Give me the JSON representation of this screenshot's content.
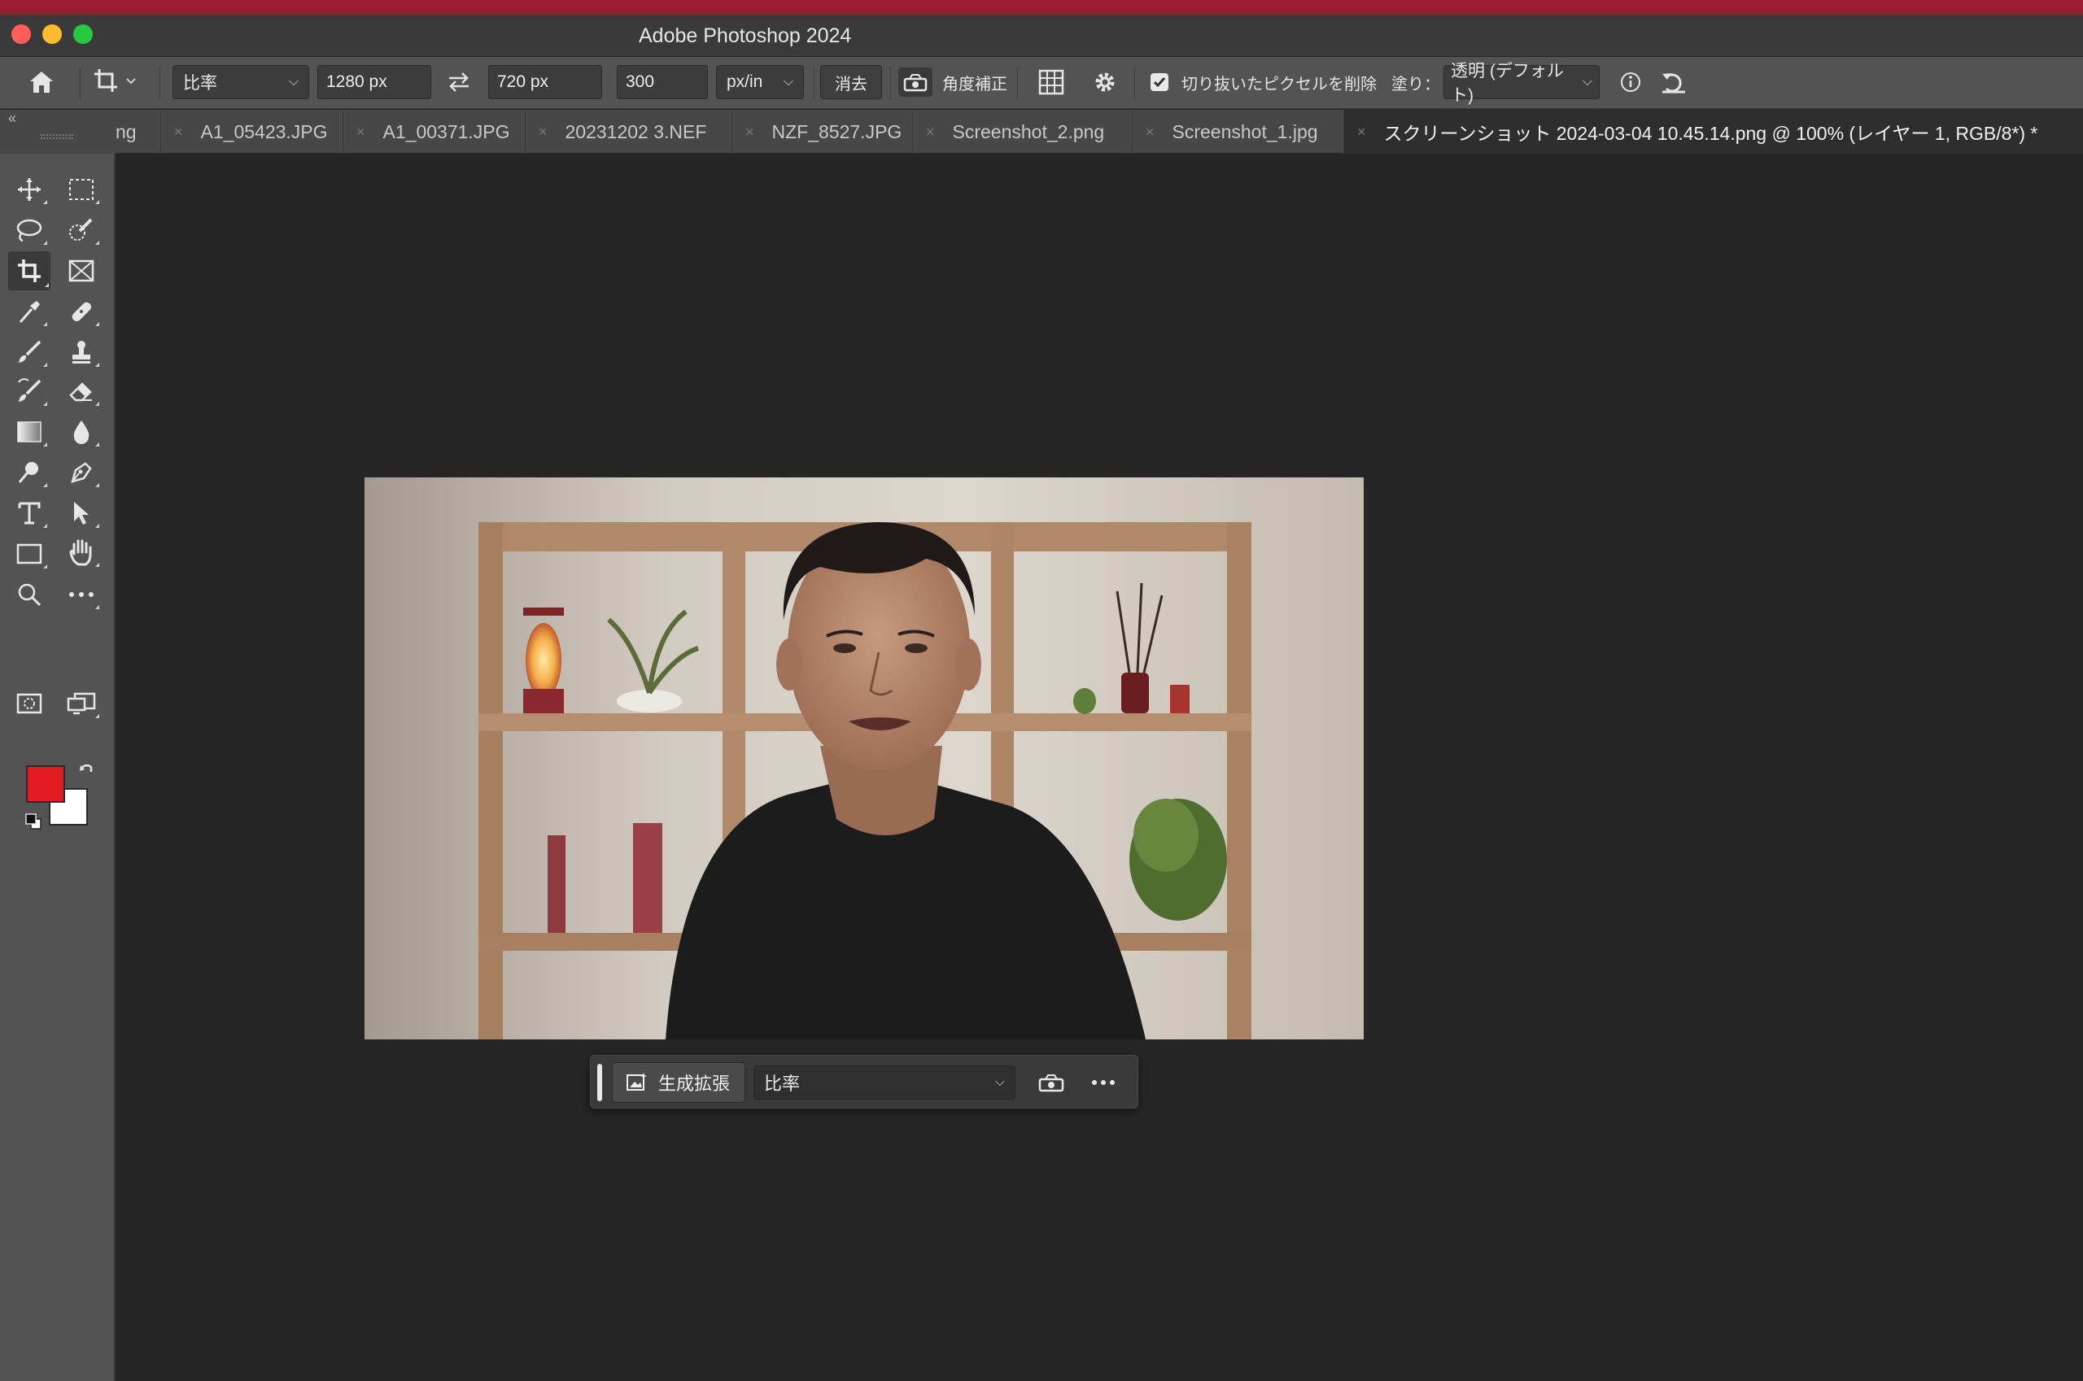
{
  "window": {
    "title": "Adobe Photoshop 2024"
  },
  "options_bar": {
    "ratio_select": "比率",
    "width_value": "1280 px",
    "height_value": "720 px",
    "resolution_value": "300",
    "resolution_unit": "px/in",
    "clear_button": "消去",
    "straighten_label": "角度補正",
    "delete_cropped_label": "切り抜いたピクセルを削除",
    "delete_cropped_checked": true,
    "fill_label": "塗り：",
    "fill_select": "透明 (デフォルト)"
  },
  "tabs": [
    {
      "label": "ng",
      "active": false
    },
    {
      "label": "A1_05423.JPG",
      "active": false
    },
    {
      "label": "A1_00371.JPG",
      "active": false
    },
    {
      "label": "20231202 3.NEF",
      "active": false
    },
    {
      "label": "NZF_8527.JPG",
      "active": false
    },
    {
      "label": "Screenshot_2.png",
      "active": false
    },
    {
      "label": "Screenshot_1.jpg",
      "active": false
    },
    {
      "label": "スクリーンショット 2024-03-04 10.45.14.png @ 100% (レイヤー 1, RGB/8*) *",
      "active": true
    }
  ],
  "colors": {
    "foreground": "#e21b23",
    "background": "#ffffff",
    "accent_strip": "#9b1b30"
  },
  "contextual_taskbar": {
    "generative_expand_label": "生成拡張",
    "ratio_select": "比率"
  }
}
